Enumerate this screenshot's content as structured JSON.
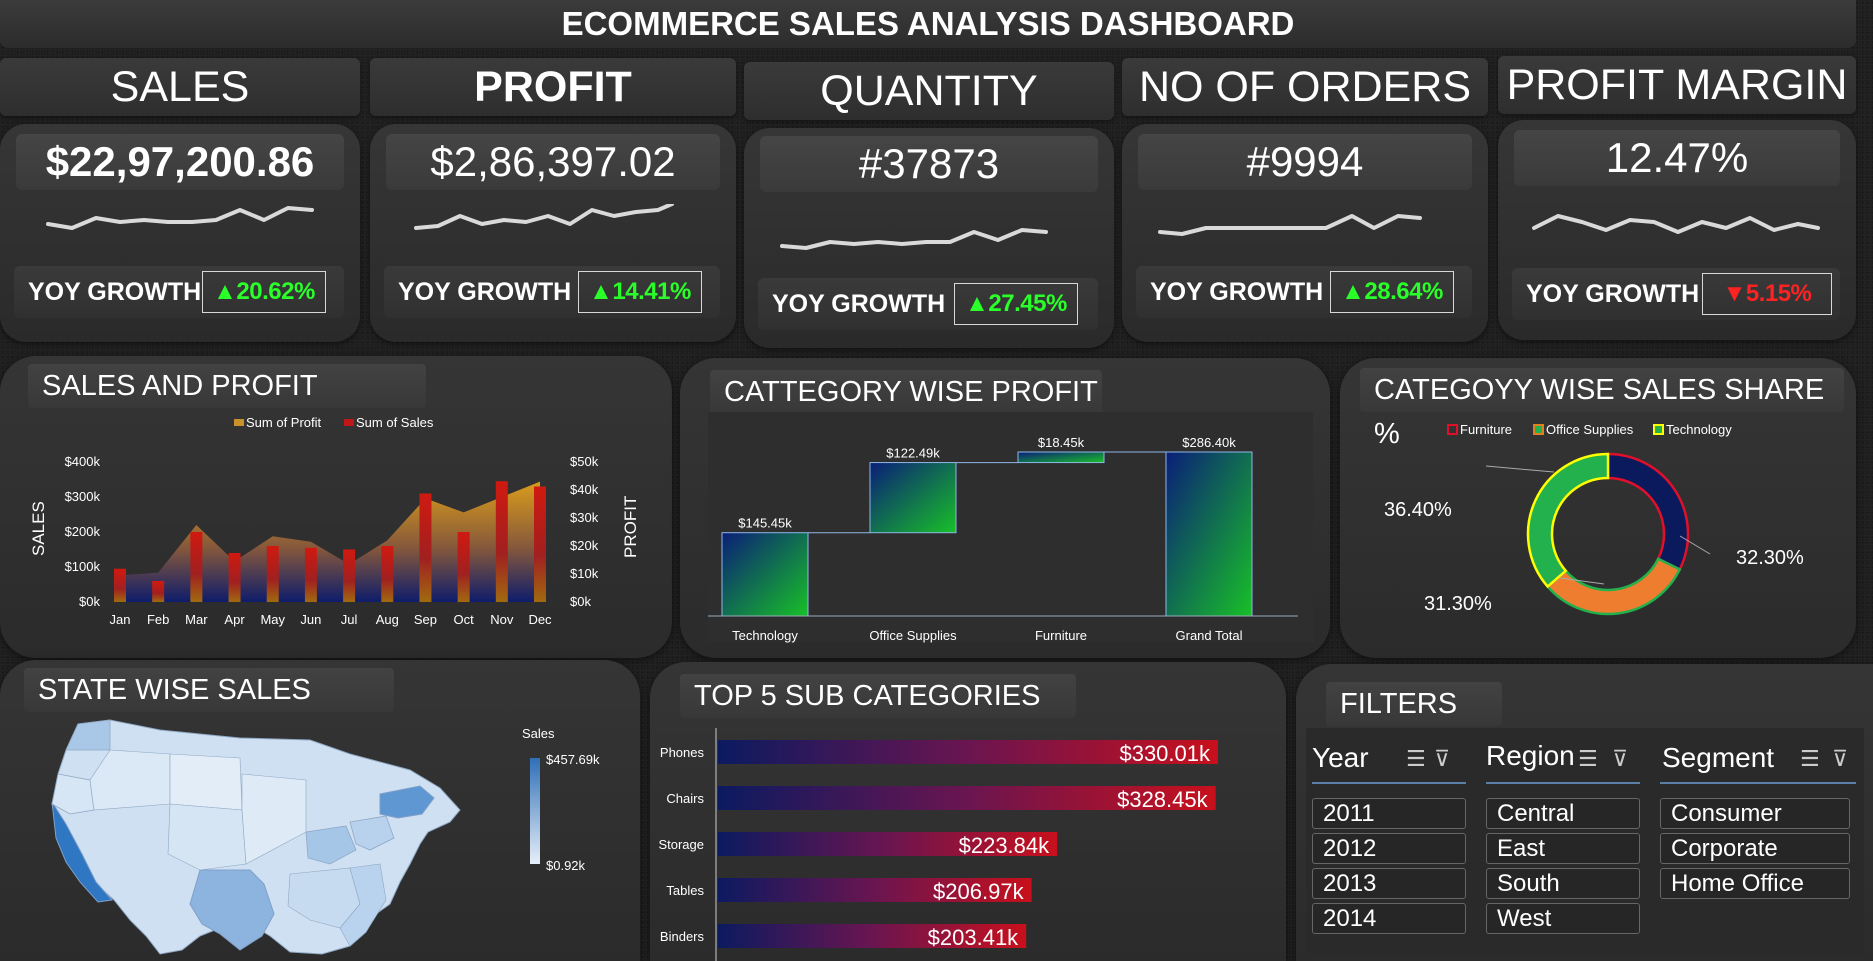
{
  "title": "ECOMMERCE SALES ANALYSIS DASHBOARD",
  "kpis": [
    {
      "label": "SALES",
      "value": "$22,97,200.86",
      "yoy_label": "YOY GROWTH",
      "yoy": "▲20.62%",
      "trend": "up"
    },
    {
      "label": "PROFIT",
      "value": "$2,86,397.02",
      "yoy_label": "YOY GROWTH",
      "yoy": "▲14.41%",
      "trend": "up"
    },
    {
      "label": "QUANTITY",
      "value": "#37873",
      "yoy_label": "YOY GROWTH",
      "yoy": "▲27.45%",
      "trend": "up"
    },
    {
      "label": "NO OF ORDERS",
      "value": "#9994",
      "yoy_label": "YOY GROWTH",
      "yoy": "▲28.64%",
      "trend": "up"
    },
    {
      "label": "PROFIT MARGIN",
      "value": "12.47%",
      "yoy_label": "YOY GROWTH",
      "yoy": "▼5.15%",
      "trend": "down"
    }
  ],
  "sales_profit": {
    "title": "SALES AND PROFIT",
    "legend": [
      "Sum of Profit",
      "Sum of Sales"
    ],
    "y_left_label": "SALES",
    "y_right_label": "PROFIT",
    "y_left_ticks": [
      "$0k",
      "$100k",
      "$200k",
      "$300k",
      "$400k"
    ],
    "y_right_ticks": [
      "$0k",
      "$10k",
      "$20k",
      "$30k",
      "$40k",
      "$50k"
    ]
  },
  "category_profit": {
    "title": "CATTEGORY WISE PROFIT",
    "labels": [
      "$145.45k",
      "$122.49k",
      "$18.45k",
      "$286.40k"
    ]
  },
  "category_share": {
    "title": "CATEGOYY WISE SALES SHARE %",
    "legend": [
      "Furniture",
      "Office Supplies",
      "Technology"
    ],
    "labels": [
      "32.30%",
      "31.30%",
      "36.40%"
    ]
  },
  "state_sales": {
    "title": "STATE WISE SALES",
    "legend_title": "Sales",
    "legend_max": "$457.69k",
    "legend_min": "$0.92k"
  },
  "top_sub": {
    "title": "TOP 5 SUB CATEGORIES",
    "labels": [
      "$330.01k",
      "$328.45k",
      "$223.84k",
      "$206.97k",
      "$203.41k"
    ]
  },
  "filters": {
    "title": "FILTERS",
    "year": {
      "label": "Year",
      "items": [
        "2011",
        "2012",
        "2013",
        "2014"
      ]
    },
    "region": {
      "label": "Region",
      "items": [
        "Central",
        "East",
        "South",
        "West"
      ]
    },
    "segment": {
      "label": "Segment",
      "items": [
        "Consumer",
        "Corporate",
        "Home Office"
      ]
    }
  },
  "chart_data": [
    {
      "type": "line",
      "title": "SALES AND PROFIT",
      "categories": [
        "Jan",
        "Feb",
        "Mar",
        "Apr",
        "May",
        "Jun",
        "Jul",
        "Aug",
        "Sep",
        "Oct",
        "Nov",
        "Dec"
      ],
      "series": [
        {
          "name": "Sum of Profit",
          "chart": "area",
          "axis": "right",
          "values": [
            9500,
            10500,
            27500,
            14500,
            23500,
            21500,
            13500,
            22000,
            37000,
            32000,
            37500,
            43000
          ],
          "color": "#d4a020"
        },
        {
          "name": "Sum of Sales",
          "chart": "bar",
          "axis": "left",
          "values": [
            95000,
            60000,
            200000,
            140000,
            160000,
            155000,
            150000,
            160000,
            310000,
            200000,
            345000,
            330000
          ],
          "color": "#c01818"
        }
      ],
      "ylim_left": [
        0,
        400000
      ],
      "ylim_right": [
        0,
        50000
      ],
      "ylabel": "SALES",
      "y2label": "PROFIT"
    },
    {
      "type": "bar",
      "subtype": "waterfall",
      "title": "CATTEGORY WISE PROFIT",
      "categories": [
        "Technology",
        "Office Supplies",
        "Furniture",
        "Grand Total"
      ],
      "values": [
        145.45,
        122.49,
        18.45,
        286.4
      ],
      "unit": "k",
      "ylim": [
        0,
        286.4
      ]
    },
    {
      "type": "pie",
      "subtype": "donut",
      "title": "CATEGOYY WISE SALES SHARE %",
      "categories": [
        "Furniture",
        "Office Supplies",
        "Technology"
      ],
      "values": [
        32.3,
        31.3,
        36.4
      ],
      "colors": [
        "#0b1a5c",
        "#ee7d2f",
        "#22b14c"
      ]
    },
    {
      "type": "bar",
      "orientation": "horizontal",
      "title": "TOP 5 SUB CATEGORIES",
      "categories": [
        "Phones",
        "Chairs",
        "Storage",
        "Tables",
        "Binders"
      ],
      "values": [
        330.01,
        328.45,
        223.84,
        206.97,
        203.41
      ],
      "unit": "k",
      "xlim": [
        0,
        330.01
      ]
    }
  ],
  "colors": {
    "accent_green": "#2aff2a",
    "accent_red": "#ff2222",
    "bar_red": "#c01818",
    "navy": "#0b1a5c",
    "green": "#22b14c",
    "orange": "#ee7d2f"
  }
}
